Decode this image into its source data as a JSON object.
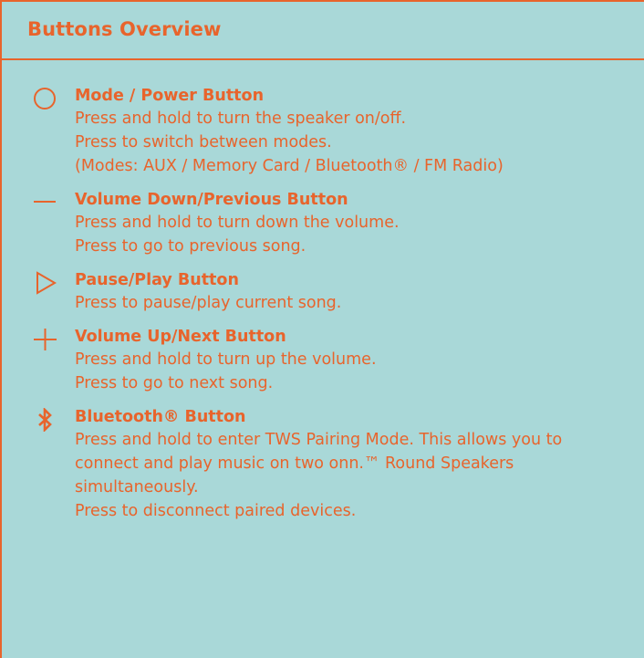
{
  "header": {
    "title": "Buttons Overview"
  },
  "items": [
    {
      "icon": "circle-icon",
      "title": "Mode / Power Button",
      "lines": [
        "Press and hold to turn the speaker on/off.",
        "Press to switch between modes.",
        "(Modes: AUX / Memory Card / Bluetooth® / FM Radio)"
      ]
    },
    {
      "icon": "minus-icon",
      "title": "Volume Down/Previous Button",
      "lines": [
        "Press and hold to turn down the volume.",
        "Press to go to previous song."
      ]
    },
    {
      "icon": "play-icon",
      "title": "Pause/Play Button",
      "lines": [
        "Press to pause/play current song."
      ]
    },
    {
      "icon": "plus-icon",
      "title": "Volume Up/Next Button",
      "lines": [
        "Press and hold to turn up the volume.",
        "Press to go to next song."
      ]
    },
    {
      "icon": "bluetooth-icon",
      "title": "Bluetooth® Button",
      "lines": [
        "Press and hold to enter TWS Pairing Mode. This allows you to",
        "connect and play music on two onn.™ Round Speakers",
        "simultaneously.",
        "Press to disconnect paired devices."
      ]
    }
  ],
  "colors": {
    "accent": "#e8642c",
    "background": "#a9d8d8"
  }
}
